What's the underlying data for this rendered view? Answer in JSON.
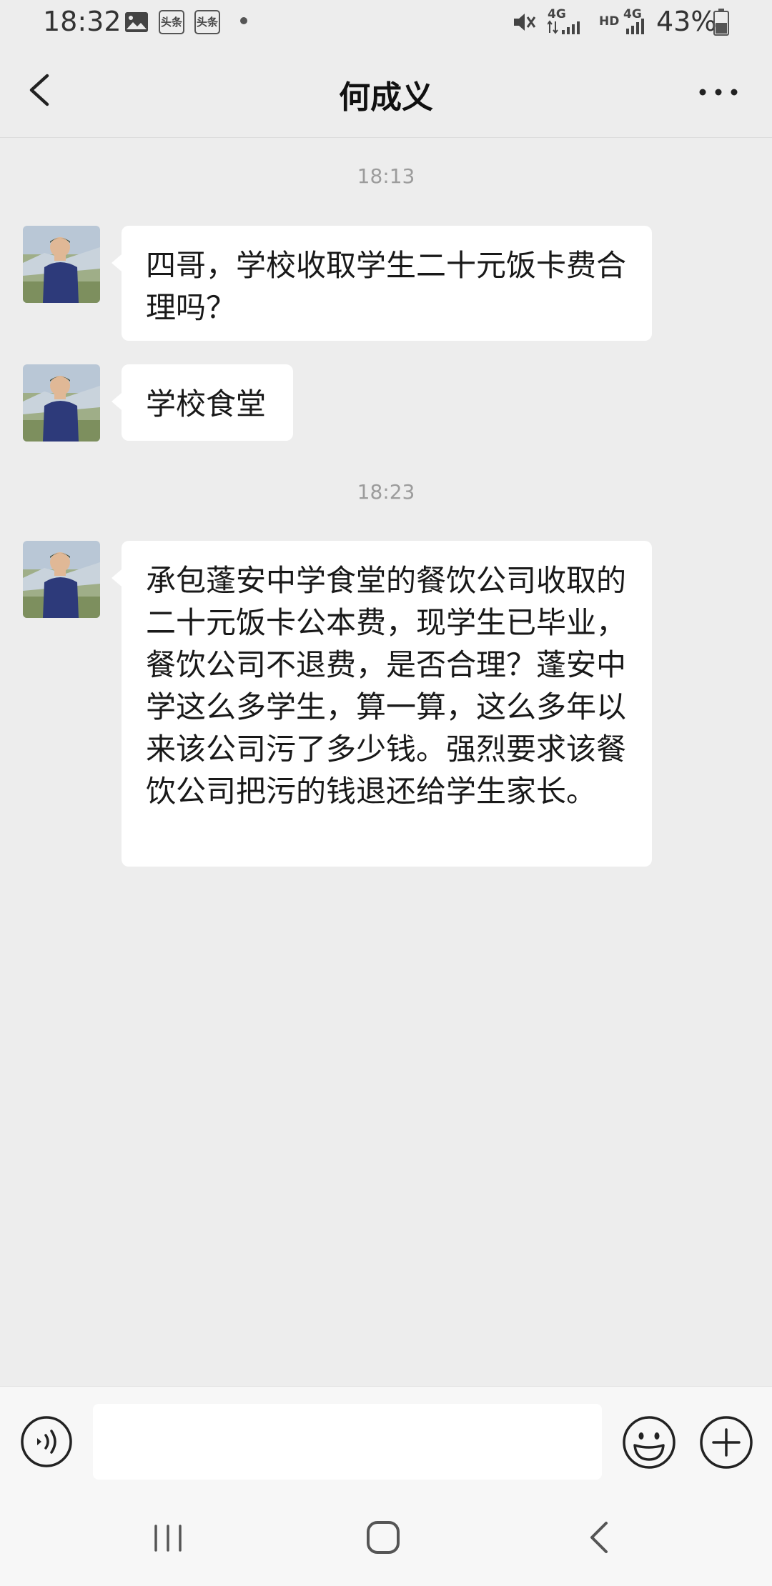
{
  "status_bar": {
    "time": "18:32",
    "app_icon_1": "头条",
    "app_icon_2": "头条",
    "signal_label_1": "4G",
    "hd_label": "HD",
    "signal_label_2": "4G",
    "battery": "43%"
  },
  "header": {
    "title": "何成义",
    "back_icon": "chevron-left-icon",
    "more_icon": "more-dots-icon"
  },
  "messages": [
    {
      "type": "time",
      "text": "18:13"
    },
    {
      "type": "received",
      "text": "四哥，学校收取学生二十元饭卡费合理吗？"
    },
    {
      "type": "received",
      "text": "学校食堂"
    },
    {
      "type": "time",
      "text": "18:23"
    },
    {
      "type": "received",
      "text": "承包蓬安中学食堂的餐饮公司收取的二十元饭卡公本费，现学生已毕业，餐饮公司不退费，是否合理？蓬安中学这么多学生，算一算，这么多年以来该公司污了多少钱。强烈要求该餐饮公司把污的钱退还给学生家长。"
    }
  ],
  "input_bar": {
    "value": "",
    "placeholder": ""
  },
  "colors": {
    "background": "#ededed",
    "bubble": "#ffffff",
    "timestamp": "#9c9c9c"
  }
}
